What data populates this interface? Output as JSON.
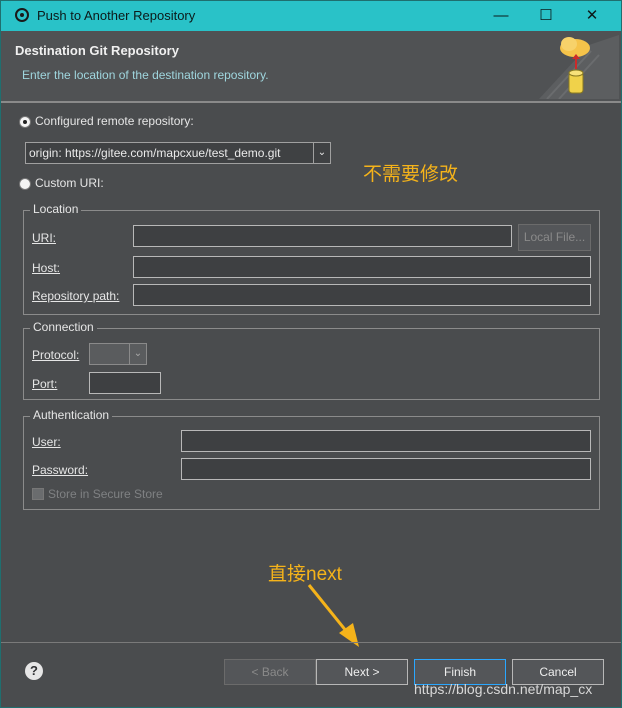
{
  "window": {
    "title": "Push to Another Repository",
    "controls": {
      "minimize": "—",
      "maximize": "☐",
      "close": "✕"
    }
  },
  "header": {
    "title": "Destination Git Repository",
    "description": "Enter the location of the destination repository."
  },
  "remote": {
    "configured_label": "Configured remote repository:",
    "configured_selected": true,
    "selected_value": "origin: https://gitee.com/mapcxue/test_demo.git",
    "custom_label": "Custom URI:"
  },
  "location": {
    "legend": "Location",
    "uri_label": "URI:",
    "uri_value": "",
    "local_file_button": "Local File...",
    "host_label": "Host:",
    "host_value": "",
    "repo_path_label": "Repository path:",
    "repo_path_value": ""
  },
  "connection": {
    "legend": "Connection",
    "protocol_label": "Protocol:",
    "protocol_value": "",
    "port_label": "Port:",
    "port_value": ""
  },
  "authentication": {
    "legend": "Authentication",
    "user_label": "User:",
    "user_value": "",
    "password_label": "Password:",
    "password_value": "",
    "store_label": "Store in Secure Store"
  },
  "annotations": {
    "no_change": "不需要修改",
    "direct_next": "直接next"
  },
  "buttons": {
    "back": "< Back",
    "next": "Next >",
    "finish": "Finish",
    "cancel": "Cancel"
  },
  "help_icon_glyph": "?",
  "watermark": "https://blog.csdn.net/map_cx",
  "colors": {
    "titlebar": "#29c2c8",
    "annotation": "#f5b31a",
    "focus": "#2aa7ff"
  }
}
